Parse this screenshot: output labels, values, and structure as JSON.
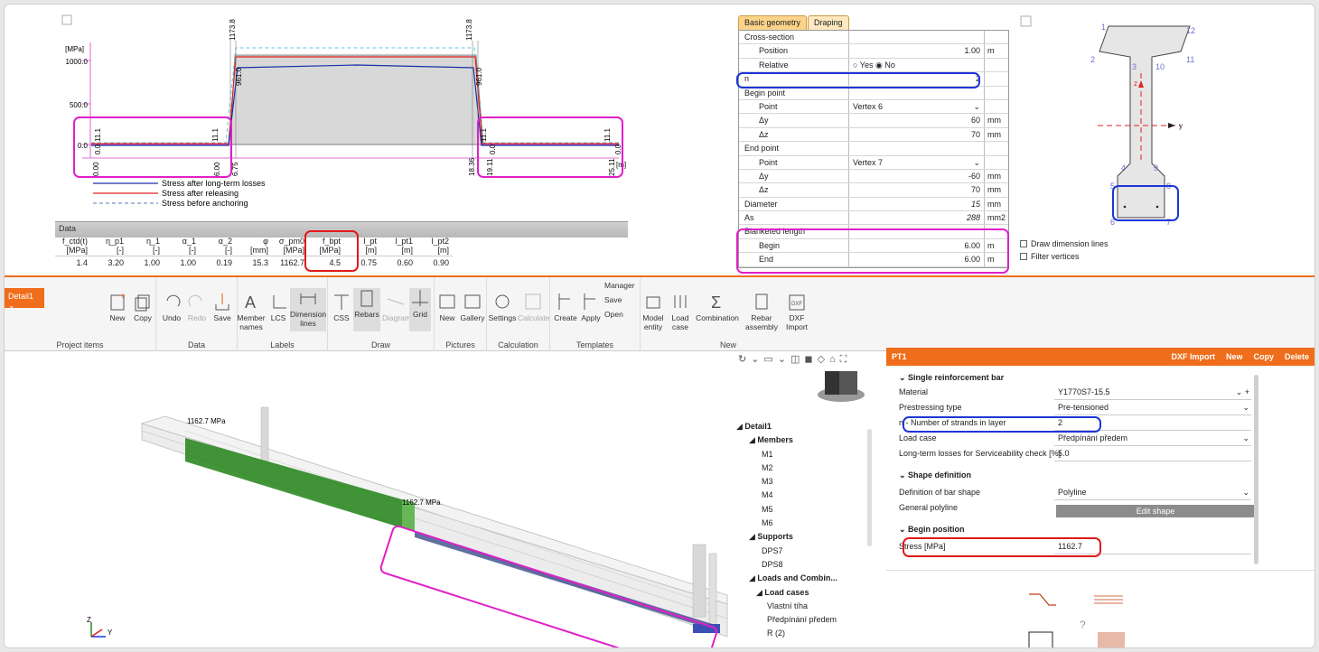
{
  "chart": {
    "unit_label": "[MPa]",
    "y_ticks": [
      "1000.0",
      "500.0",
      "0.0"
    ],
    "top_labels": [
      "1173.8",
      "1173.8"
    ],
    "vertical_labels": [
      "11.1",
      "11.1",
      "11.1",
      "11.1",
      "961.0",
      "961.0",
      "0.0",
      "0.0",
      "0.0"
    ],
    "x_labels": [
      "0.00",
      "6.00",
      "6.75",
      "18.36",
      "19.11",
      "25.11"
    ],
    "x_unit": "[m]",
    "legend": [
      "Stress after long-term losses",
      "Stress after releasing",
      "Stress before anchoring"
    ],
    "colors": {
      "long_term": "#1a2ea8",
      "releasing": "#e02020",
      "before": "#5a7ab8",
      "fill": "#d8d8d8"
    }
  },
  "data_bar": {
    "label": "Data"
  },
  "params_table": {
    "headers": [
      {
        "name": "f_ctd(t)",
        "unit": "[MPa]"
      },
      {
        "name": "η_p1",
        "unit": "[-]"
      },
      {
        "name": "η_1",
        "unit": "[-]"
      },
      {
        "name": "α_1",
        "unit": "[-]"
      },
      {
        "name": "α_2",
        "unit": "[-]"
      },
      {
        "name": "φ",
        "unit": "[mm]"
      },
      {
        "name": "σ_pm0",
        "unit": "[MPa]"
      },
      {
        "name": "f_bpt",
        "unit": "[MPa]"
      },
      {
        "name": "l_pt",
        "unit": "[m]"
      },
      {
        "name": "l_pt1",
        "unit": "[m]"
      },
      {
        "name": "l_pt2",
        "unit": "[m]"
      }
    ],
    "values": [
      "1.4",
      "3.20",
      "1.00",
      "1.00",
      "0.19",
      "15.3",
      "1162.7",
      "4.5",
      "0.75",
      "0.60",
      "0.90"
    ]
  },
  "tabs": [
    "Basic geometry",
    "Draping"
  ],
  "geometry": {
    "cross_section": "Cross-section",
    "position_label": "Position",
    "position_value": "1.00",
    "position_unit": "m",
    "relative_label": "Relative",
    "relative_yes": "Yes",
    "relative_no": "No",
    "n_label": "n",
    "n_value": "2",
    "begin_point": "Begin point",
    "point_label": "Point",
    "begin_vertex": "Vertex 6",
    "dy_label": "Δy",
    "dz_label": "Δz",
    "begin_dy": "60",
    "begin_dz": "70",
    "mm": "mm",
    "end_point": "End point",
    "end_vertex": "Vertex 7",
    "end_dy": "-60",
    "end_dz": "70",
    "diameter_label": "Diameter",
    "diameter_value": "15",
    "as_label": "As",
    "as_value": "288",
    "mm2": "mm2",
    "blanketed": "Blanketed length",
    "begin_label": "Begin",
    "begin_value": "6.00",
    "end_label": "End",
    "end_value": "6.00",
    "m": "m"
  },
  "section": {
    "vertices": [
      "1",
      "12",
      "2",
      "3",
      "10",
      "11",
      "4",
      "9",
      "5",
      "8",
      "6",
      "7"
    ],
    "axis_z": "z",
    "axis_y": "y"
  },
  "options": {
    "draw_dimension_lines": "Draw dimension lines",
    "filter_vertices": "Filter vertices"
  },
  "ribbon": {
    "detail": "Detail1",
    "groups": [
      "Project items",
      "Data",
      "Labels",
      "Draw",
      "Pictures",
      "Calculation",
      "Templates",
      "New"
    ],
    "buttons": {
      "new": "New",
      "copy": "Copy",
      "undo": "Undo",
      "redo": "Redo",
      "save": "Save",
      "member_names": "Member names",
      "lcs": "LCS",
      "dimension_lines": "Dimension lines",
      "css": "CSS",
      "rebars": "Rebars",
      "diagram": "Diagram",
      "grid": "Grid",
      "new_pic": "New",
      "gallery": "Gallery",
      "settings": "Settings",
      "calculate": "Calculate",
      "create": "Create",
      "apply": "Apply",
      "manager": "Manager",
      "tsave": "Save",
      "open": "Open",
      "model_entity": "Model entity",
      "load_case": "Load case",
      "combination": "Combination",
      "rebar_assembly": "Rebar assembly",
      "dxf_import": "DXF Import",
      "dxf_icon": "DXF"
    }
  },
  "viewport": {
    "label1": "1162.7 MPa",
    "label2": "1162.7 MPa",
    "axis_z": "Z",
    "axis_y": "Y"
  },
  "tree": {
    "root": "Detail1",
    "members": "Members",
    "member_items": [
      "M1",
      "M2",
      "M3",
      "M4",
      "M5",
      "M6"
    ],
    "supports": "Supports",
    "support_items": [
      "DPS7",
      "DPS8"
    ],
    "loads": "Loads and Combin...",
    "load_cases": "Load cases",
    "load_items": [
      "Vlastní tíha",
      "Předpínání předem",
      "R (2)"
    ]
  },
  "panel": {
    "title": "PT1",
    "actions": [
      "DXF Import",
      "New",
      "Copy",
      "Delete"
    ],
    "section_single": "Single reinforcement bar",
    "material_label": "Material",
    "material_value": "Y1770S7-15.5",
    "prestressing_label": "Prestressing type",
    "prestressing_value": "Pre-tensioned",
    "strands_label": "n - Number of strands in layer",
    "strands_value": "2",
    "loadcase_label": "Load case",
    "loadcase_value": "Předpínání předem",
    "losses_label": "Long-term losses for Serviceability check [%]",
    "losses_value": "5.0",
    "section_shape": "Shape definition",
    "bar_shape_label": "Definition of bar shape",
    "bar_shape_value": "Polyline",
    "polyline_label": "General polyline",
    "edit_shape": "Edit shape",
    "section_begin": "Begin position",
    "stress_label": "Stress [MPa]",
    "stress_value": "1162.7"
  }
}
